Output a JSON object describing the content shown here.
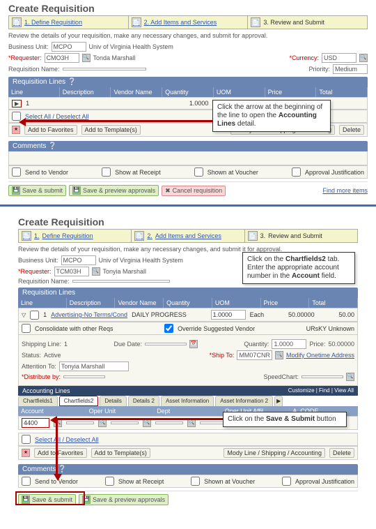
{
  "top": {
    "title": "Create Requisition",
    "steps": [
      {
        "num": "1.",
        "label": "Define Requisition"
      },
      {
        "num": "2.",
        "label": "Add Items and Services"
      },
      {
        "num": "3.",
        "label": "Review and Submit"
      }
    ],
    "caption": "Review the details of your requisition, make any necessary changes, and submit for approval.",
    "buLabel": "Business Unit:",
    "buValue": "MCPO",
    "buDesc": "Univ of Virginia Health System",
    "reqrLabel": "*Requester:",
    "reqrValue": "CMO3H",
    "reqrName": "Tonda Marshall",
    "currLabel": "*Currency:",
    "currValue": "USD",
    "reqNameLabel": "Requisition Name:",
    "prioLabel": "Priority:",
    "prioValue": "Medium",
    "reqLinesHeader": "Requisition Lines",
    "cols": [
      "Line",
      "Description",
      "Vendor Name",
      "Quantity",
      "UOM",
      "Price",
      "Total"
    ],
    "lineTriangle": "▶",
    "lineNum": "1",
    "qty": "1.0000",
    "selectAll": "Select All / Deselect All",
    "addFav": "Add to Favorites",
    "addTpl": "Add to Template(s)",
    "modLine": "Modify Line / Shipping / Accounting",
    "delete": "Delete",
    "commentsHeader": "Comments",
    "sendVendor": "Send to Vendor",
    "showReceipt": "Show at Receipt",
    "showVoucher": "Shown at Voucher",
    "appJust": "Approval Justification",
    "saveSubmit": "Save & submit",
    "savePreview": "Save & preview approvals",
    "cancelReq": "Cancel requisition",
    "findMore": "Find more items",
    "callout1": "Click the arrow at the beginning of the line to open the <b>Accounting Lines</b> detail."
  },
  "bottom": {
    "title": "Create Requisition",
    "steps": [
      {
        "num": "1.",
        "label": "Define Requisition"
      },
      {
        "num": "2.",
        "label": "Add Items and Services"
      },
      {
        "num": "3.",
        "label": "Review and Submit"
      }
    ],
    "caption": "Review the details of your requisition, make any necessary changes, and submit it for approval.",
    "buLabel": "Business Unit:",
    "buValue": "MCPO",
    "buDesc": "Univ of Virginia Health System",
    "reqrLabel": "*Requester:",
    "reqrValue": "TCM03H",
    "reqrName": "Tonyia Marshall",
    "reqNameLabel": "Requisition Name:",
    "callout2": "Click on the <b>Chartfields2</b> tab. Enter the appropriate account number in the <b>Account</b> field.",
    "reqLinesHeader": "Requisition Lines",
    "cols": [
      "Line",
      "Description",
      "Vendor Name",
      "Quantity",
      "UOM",
      "Price",
      "Total"
    ],
    "row1": {
      "line": "1",
      "desc": "Advertising-No Terms/Cond",
      "vendor": "DAILY PROGRESS",
      "qty": "1.0000",
      "uom": "Each",
      "price": "50.00000",
      "total": "50.00"
    },
    "consolidate": "Consolidate with other Reqs",
    "override": "Override Suggested Vendor",
    "merch": "URsKY Unknown",
    "shipLine": "Shipping Line:",
    "ship1": "1",
    "due": "Due Date:",
    "qtyL": "Quantity:",
    "qtyV": "1.0000",
    "priceL": "Price:",
    "priceV": "50.00000",
    "status": "Status:",
    "statusV": "Active",
    "shipTo": "*Ship To:",
    "shipToV": "MM07CNR",
    "modAddr": "Modify Onetime Address",
    "attn": "Attention To:",
    "attnV": "Tonyia Marshall",
    "distBy": "*Distribute by:",
    "speed": "SpeedChart:",
    "acctLines": "Accounting Lines",
    "custFind": "Customize | Find | View All",
    "tabs": [
      "Chartfields1",
      "Chartfields2",
      "Details",
      "Details 2",
      "Asset Information",
      "Asset Information 2"
    ],
    "tableCols": [
      "Account",
      "Oper Unit",
      "Dept",
      "Oper Unit Affil",
      "A_CODE"
    ],
    "accountVal": "4400",
    "selectAll": "Select All / Deselect All",
    "addFav": "Add to Favorites",
    "addTpl": "Add to Template(s)",
    "modLine": "Mody Line / Shipping / Accounting",
    "delete": "Delete",
    "commentsHeader": "Comments",
    "sendVendor": "Send to Vendor",
    "showReceipt": "Show at Receipt",
    "showVoucher": "Shown at Voucher",
    "appJust": "Approval Justification",
    "saveSubmit": "Save & submit",
    "savePreview": "Save & preview approvals",
    "callout3": "Click on the <b>Save & Submit</b> button"
  }
}
